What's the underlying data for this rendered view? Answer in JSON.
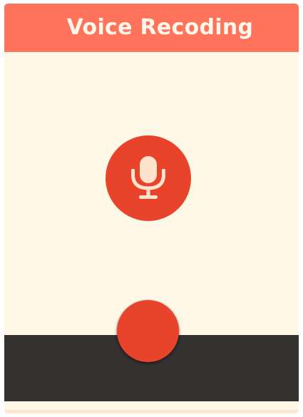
{
  "app": {
    "title": "Voice Recoding"
  },
  "colors": {
    "header": "#ff735c",
    "content_bg": "#fff8e6",
    "accent": "#e8442c",
    "bottom_bar": "#343230",
    "frame_edge": "#fde5cf",
    "title_text": "#fff7ea",
    "icon_fill": "#fde2cc"
  },
  "icons": {
    "mic": "microphone-icon"
  }
}
